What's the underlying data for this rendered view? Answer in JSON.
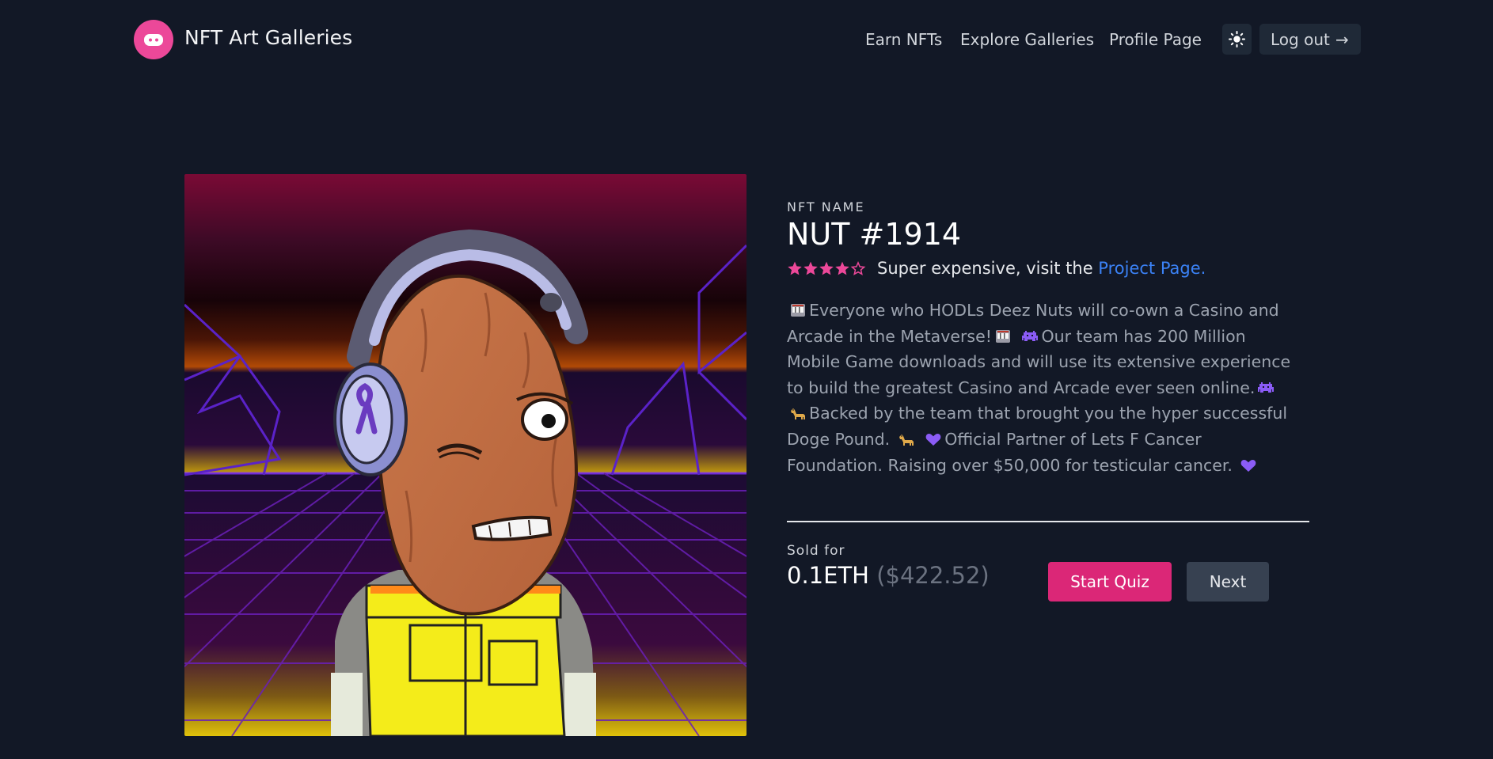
{
  "header": {
    "brand": "NFT Art Galleries",
    "nav": [
      "Earn NFTs",
      "Explore Galleries",
      "Profile Page"
    ],
    "logout_label": "Log out",
    "logout_arrow": "→"
  },
  "nft": {
    "eyebrow": "NFT NAME",
    "title": "NUT #1914",
    "rating": {
      "value": 4,
      "max": 5
    },
    "rating_text_prefix": "Super expensive, visit the ",
    "rating_link": "Project Page.",
    "description": {
      "p1": "Everyone who HODLs Deez Nuts will co-own a Casino and Arcade in the Metaverse!",
      "p2": "Our team has 200 Million Mobile Game downloads and will use its extensive experience to build the greatest Casino and Arcade ever seen online.",
      "p3": "Backed by the team that brought you the hyper successful Doge Pound.",
      "p4": "Official Partner of Lets F Cancer Foundation. Raising over $50,000 for testicular cancer."
    },
    "sold_label": "Sold for",
    "price_eth": "0.1ETH",
    "price_usd": "($422.52)"
  },
  "actions": {
    "start_quiz": "Start Quiz",
    "next": "Next"
  },
  "colors": {
    "background": "#121826",
    "accent_pink": "#db2777",
    "star_pink": "#ec4899",
    "link_blue": "#3b82f6"
  },
  "icons": [
    "logo-icon",
    "sun-icon",
    "arrow-right-icon",
    "star-icon",
    "slot-machine-emoji",
    "alien-monster-emoji",
    "dog-emoji",
    "purple-heart-emoji"
  ]
}
